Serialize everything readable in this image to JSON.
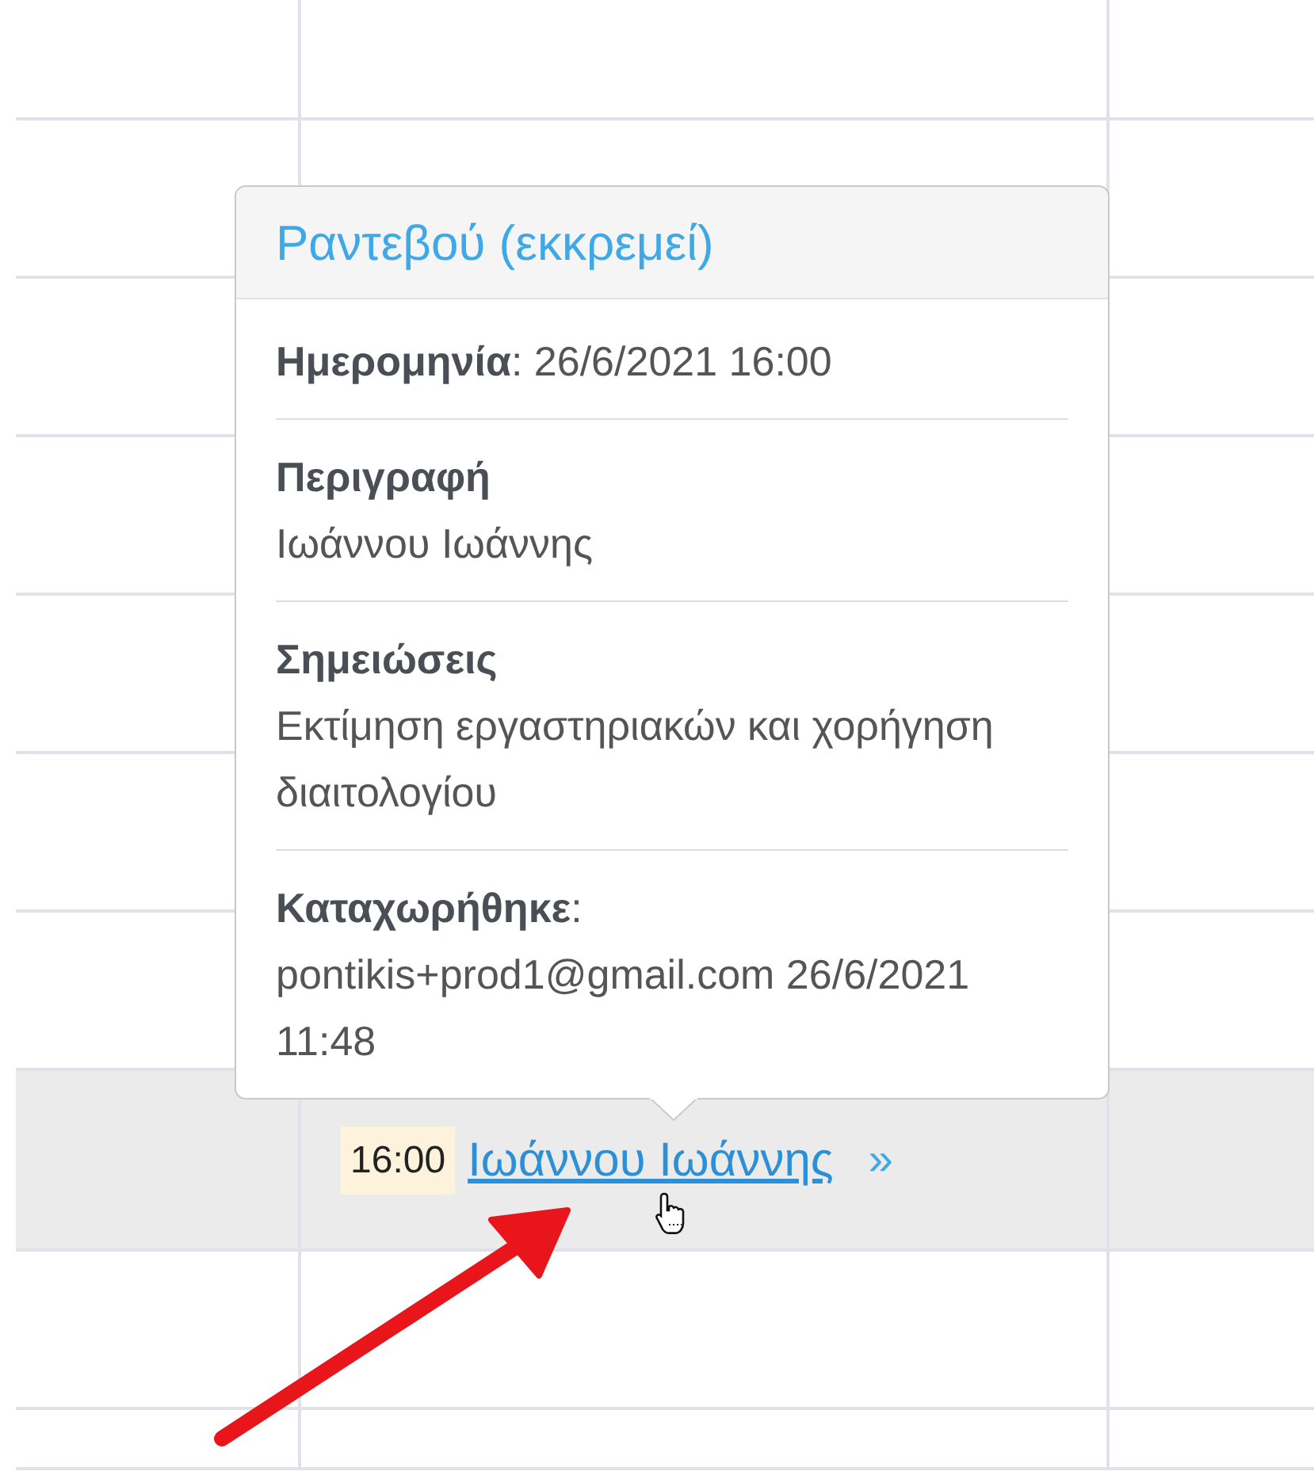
{
  "popover": {
    "title": "Ραντεβού (εκκρεμεί)",
    "sections": [
      {
        "text": "**Ημερομηνία**: 26/6/2021 16:00"
      },
      {
        "heading": "Περιγραφή",
        "text": "Ιωάννου Ιωάννης"
      },
      {
        "heading": "Σημειώσεις",
        "text": "Εκτίμηση εργαστηριακών και χορήγηση διαιτολογίου"
      },
      {
        "text": "**Καταχωρήθηκε**: pontikis+prod1@gmail.com 26/6/2021 11:48"
      }
    ]
  },
  "event": {
    "time": "16:00",
    "title": "Ιωάννου Ιωάννης",
    "more": "»"
  }
}
